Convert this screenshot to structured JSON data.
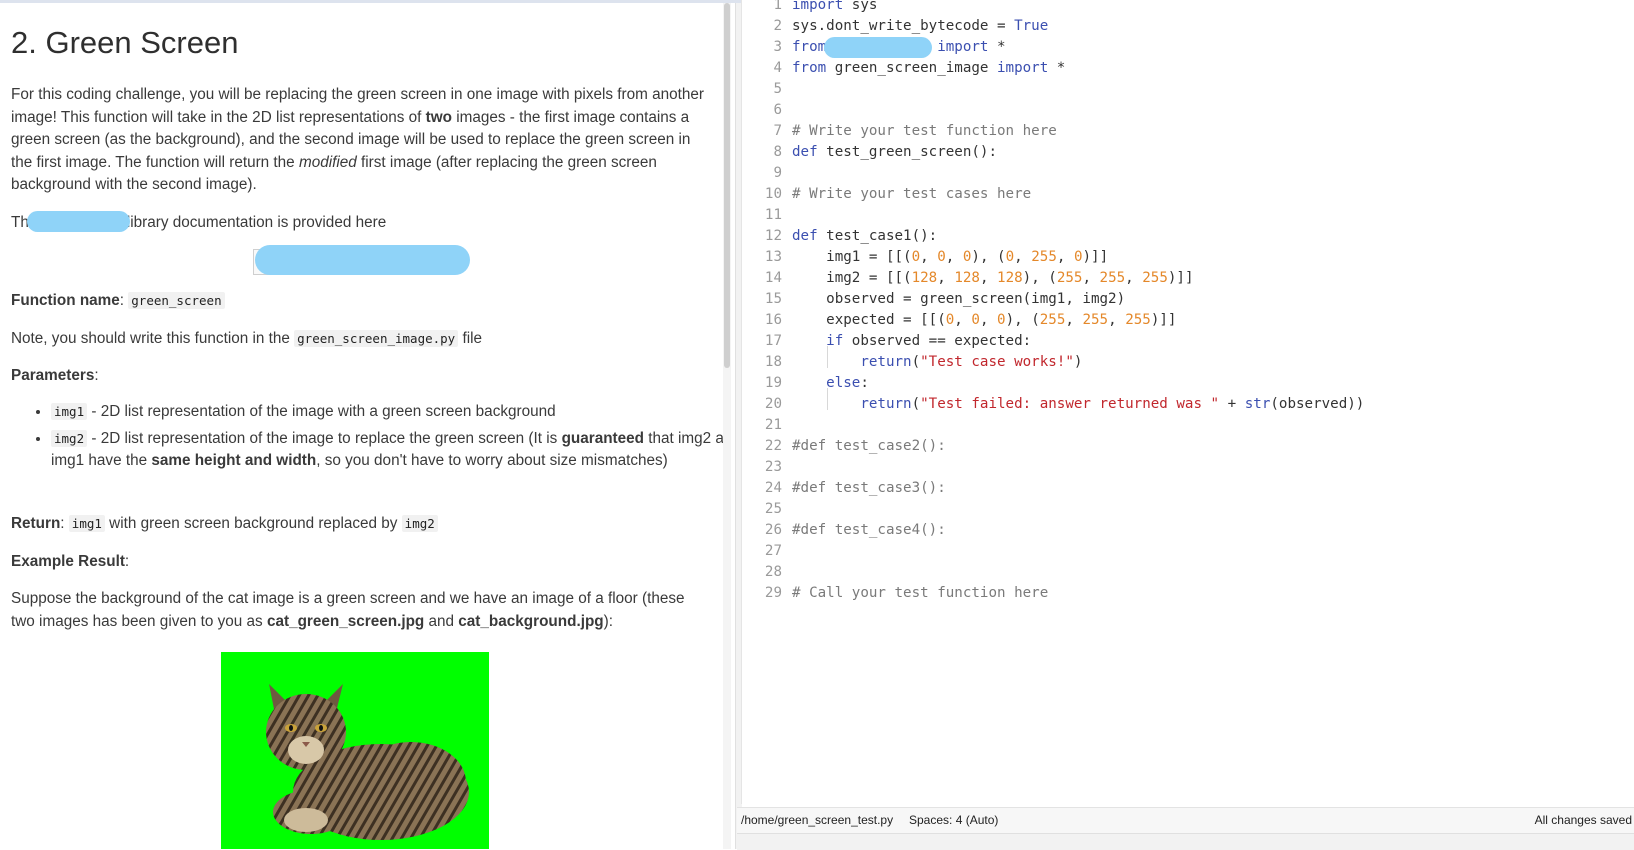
{
  "instructions": {
    "title": "2. Green Screen",
    "intro": {
      "a": "For this coding challenge, you will be replacing the green screen in one image with pixels from another image! This function will take in the 2D list representations of ",
      "b": "two",
      "c": " images - the first image contains a green screen (as the background), and the second image will be used to replace the green screen in the first image. The function will return the ",
      "d": "modified",
      "e": " first image (after replacing the green screen background with the second image)."
    },
    "doc_line": {
      "prefix": "Th",
      "suffix": "library documentation is provided here"
    },
    "function_name_label": "Function name",
    "function_name": "green_screen",
    "note": {
      "a": "Note, you should write this function in the ",
      "file": "green_screen_image.py",
      "b": " file"
    },
    "parameters_label": "Parameters",
    "param1": {
      "name": "img1",
      "desc": " - 2D list representation of the image with a green screen background"
    },
    "param2": {
      "name": "img2",
      "a": " - 2D list representation of the image to replace the green screen (It is ",
      "b": "guaranteed",
      "c": " that img2 and img1 have the ",
      "d": "same height and width",
      "e": ", so you don't have to worry about size mismatches)"
    },
    "return_label": "Return",
    "return": {
      "code1": "img1",
      "text": " with green screen background replaced by ",
      "code2": "img2"
    },
    "example_label": "Example Result",
    "example": {
      "a": "Suppose the background of the cat image is a green screen and we have an image of a floor (these two images has been given to you as ",
      "file1": "cat_green_screen.jpg",
      "b": " and ",
      "file2": "cat_background.jpg",
      "c": "):"
    }
  },
  "editor": {
    "lines": [
      {
        "n": "1",
        "html": "<span class=\"kw\">import</span> sys"
      },
      {
        "n": "2",
        "html": "sys.dont_write_bytecode = <span class=\"kw\">True</span>"
      },
      {
        "n": "3",
        "html": "<span class=\"kw\">from</span>             <span class=\"kw\">import</span> *"
      },
      {
        "n": "4",
        "html": "<span class=\"kw\">from</span> green_screen_image <span class=\"kw\">import</span> *"
      },
      {
        "n": "5",
        "html": ""
      },
      {
        "n": "6",
        "html": ""
      },
      {
        "n": "7",
        "html": "<span class=\"cm\"># Write your test function here</span>"
      },
      {
        "n": "8",
        "html": "<span class=\"kw\">def</span> test_green_screen():"
      },
      {
        "n": "9",
        "html": ""
      },
      {
        "n": "10",
        "html": "<span class=\"cm\"># Write your test cases here</span>"
      },
      {
        "n": "11",
        "html": ""
      },
      {
        "n": "12",
        "html": "<span class=\"kw\">def</span> test_case1():"
      },
      {
        "n": "13",
        "html": "    img1 = [[(<span class=\"num\">0</span>, <span class=\"num\">0</span>, <span class=\"num\">0</span>), (<span class=\"num\">0</span>, <span class=\"num\">255</span>, <span class=\"num\">0</span>)]]"
      },
      {
        "n": "14",
        "html": "    img2 = [[(<span class=\"num\">128</span>, <span class=\"num\">128</span>, <span class=\"num\">128</span>), (<span class=\"num\">255</span>, <span class=\"num\">255</span>, <span class=\"num\">255</span>)]]"
      },
      {
        "n": "15",
        "html": "    observed = green_screen(img1, img2)"
      },
      {
        "n": "16",
        "html": "    expected = [[(<span class=\"num\">0</span>, <span class=\"num\">0</span>, <span class=\"num\">0</span>), (<span class=\"num\">255</span>, <span class=\"num\">255</span>, <span class=\"num\">255</span>)]]"
      },
      {
        "n": "17",
        "html": "    <span class=\"kw\">if</span> observed == expected:"
      },
      {
        "n": "18",
        "html": "        <span class=\"kw\">return</span>(<span class=\"str\">\"Test case works!\"</span>)"
      },
      {
        "n": "19",
        "html": "    <span class=\"kw\">else</span>:"
      },
      {
        "n": "20",
        "html": "        <span class=\"kw\">return</span>(<span class=\"str\">\"Test failed: answer returned was \"</span> + <span class=\"kw\">str</span>(observed))"
      },
      {
        "n": "21",
        "html": ""
      },
      {
        "n": "22",
        "html": "<span class=\"cm\">#def test_case2():</span>"
      },
      {
        "n": "23",
        "html": ""
      },
      {
        "n": "24",
        "html": "<span class=\"cm\">#def test_case3():</span>"
      },
      {
        "n": "25",
        "html": ""
      },
      {
        "n": "26",
        "html": "<span class=\"cm\">#def test_case4():</span>"
      },
      {
        "n": "27",
        "html": ""
      },
      {
        "n": "28",
        "html": ""
      },
      {
        "n": "29",
        "html": "<span class=\"cm\"># Call your test function here</span>"
      }
    ]
  },
  "status": {
    "path": "/home/green_screen_test.py",
    "spaces": "Spaces: 4 (Auto)",
    "saved": "All changes saved"
  }
}
